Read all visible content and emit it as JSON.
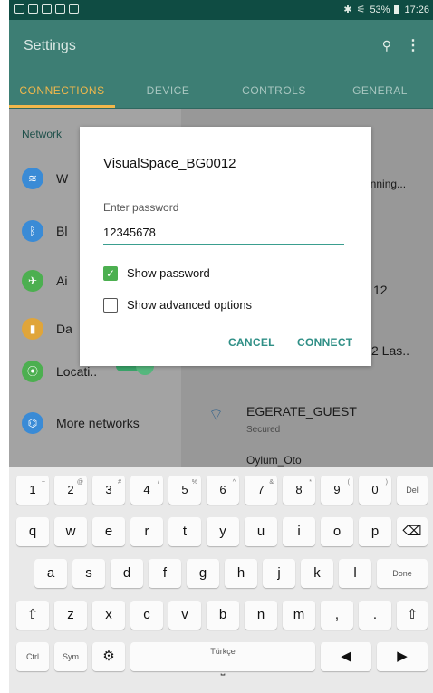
{
  "status_bar": {
    "battery": "53%",
    "time": "17:26",
    "icons": [
      "notification-icon",
      "notification-icon",
      "gallery-icon",
      "search-icon",
      "screenshot-icon",
      "bluetooth-icon",
      "wifi-icon",
      "battery-icon"
    ]
  },
  "app": {
    "title": "Settings"
  },
  "tabs": [
    {
      "label": "CONNECTIONS",
      "active": true
    },
    {
      "label": "DEVICE",
      "active": false
    },
    {
      "label": "CONTROLS",
      "active": false
    },
    {
      "label": "GENERAL",
      "active": false
    }
  ],
  "left_pane": {
    "section": "Network",
    "items": [
      {
        "label": "W",
        "icon": "wifi-icon",
        "color": "#3a8bd6"
      },
      {
        "label": "Bl",
        "icon": "bluetooth-icon",
        "color": "#3a8bd6"
      },
      {
        "label": "Ai",
        "icon": "airplane-icon",
        "color": "#4caf50"
      },
      {
        "label": "Da",
        "icon": "data-usage-icon",
        "color": "#e0a53a"
      },
      {
        "label": "Locati..",
        "icon": "location-icon",
        "color": "#4caf50"
      },
      {
        "label": "More networks",
        "icon": "more-networks-icon",
        "color": "#3a8bd6"
      }
    ]
  },
  "right_pane": {
    "scanning": "anning...",
    "text_12": "12",
    "text_2las": "2 Las..",
    "network_name": "EGERATE_GUEST",
    "network_status": "Secured",
    "network_partial": "Oylum_Oto"
  },
  "dialog": {
    "title": "VisualSpace_BG0012",
    "password_label": "Enter password",
    "password_value": "12345678",
    "show_password": "Show password",
    "show_password_checked": true,
    "show_advanced": "Show advanced options",
    "show_advanced_checked": false,
    "cancel": "CANCEL",
    "connect": "CONNECT"
  },
  "keyboard": {
    "row_numbers": [
      {
        "k": "1",
        "s": "~"
      },
      {
        "k": "2",
        "s": "@"
      },
      {
        "k": "3",
        "s": "#"
      },
      {
        "k": "4",
        "s": "/"
      },
      {
        "k": "5",
        "s": "%"
      },
      {
        "k": "6",
        "s": "^"
      },
      {
        "k": "7",
        "s": "&"
      },
      {
        "k": "8",
        "s": "*"
      },
      {
        "k": "9",
        "s": "("
      },
      {
        "k": "0",
        "s": ")"
      },
      {
        "k": "Del",
        "s": ""
      }
    ],
    "row1": [
      "q",
      "w",
      "e",
      "r",
      "t",
      "y",
      "u",
      "i",
      "o",
      "p"
    ],
    "row2": [
      "a",
      "s",
      "d",
      "f",
      "g",
      "h",
      "j",
      "k",
      "l"
    ],
    "row3": [
      "z",
      "x",
      "c",
      "v",
      "b",
      "n",
      "m",
      ",",
      "."
    ],
    "done": "Done",
    "ctrl": "Ctrl",
    "sym": "Sym",
    "space_label": "Türkçe"
  },
  "colors": {
    "accent": "#3d7e74",
    "tab_active": "#f2b84b",
    "dialog_button": "#2f8f86",
    "checkbox": "#4caf50"
  }
}
